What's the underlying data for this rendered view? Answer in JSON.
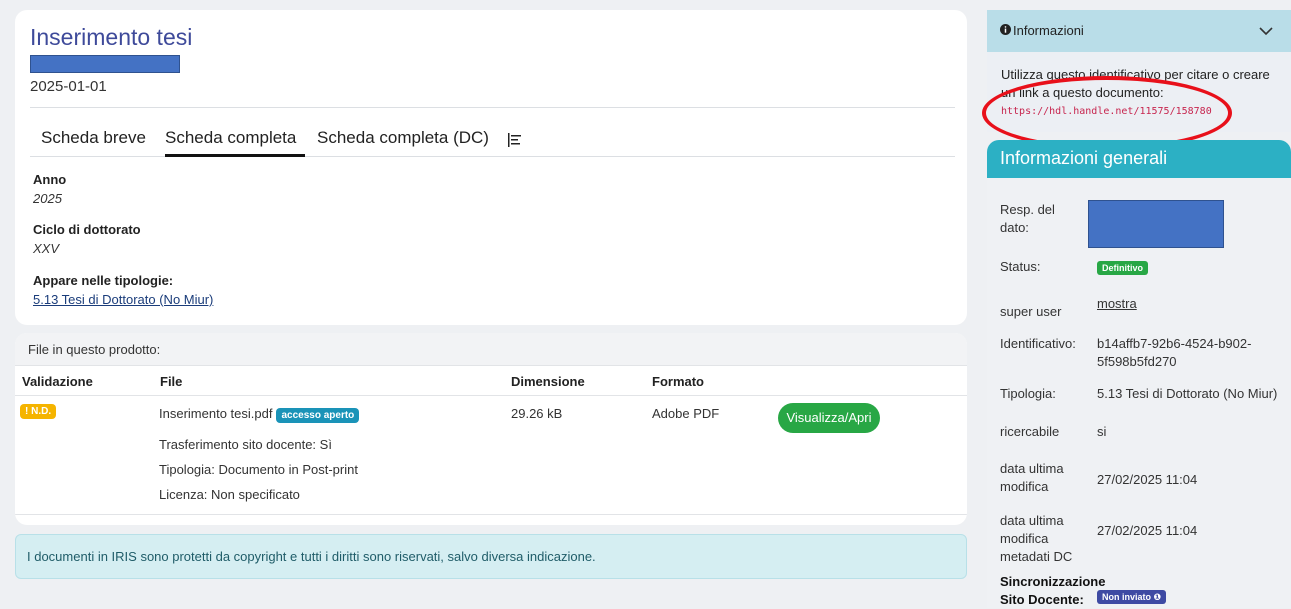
{
  "record": {
    "title": "Inserimento tesi",
    "date": "2025-01-01"
  },
  "tabs": [
    "Scheda breve",
    "Scheda completa",
    "Scheda completa (DC)"
  ],
  "fields": {
    "anno_label": "Anno",
    "anno_value": "2025",
    "ciclo_label": "Ciclo di dottorato",
    "ciclo_value": "XXV",
    "tipologie_label": "Appare nelle tipologie:",
    "tipologie_value": "5.13 Tesi di Dottorato (No Miur)"
  },
  "files": {
    "header": "File in questo prodotto:",
    "columns": [
      "Validazione",
      "File",
      "Dimensione",
      "Formato"
    ],
    "row": {
      "validation": "! N.D.",
      "filename": "Inserimento tesi.pdf",
      "access": "accesso aperto",
      "size": "29.26 kB",
      "format": "Adobe PDF",
      "button": "Visualizza/Apri",
      "details": [
        "Trasferimento sito docente: Sì",
        "Tipologia: Documento in Post-print",
        "Licenza: Non specificato"
      ]
    }
  },
  "notice": "I documenti in IRIS sono protetti da copyright e tutti i diritti sono riservati, salvo diversa indicazione.",
  "info_panel": {
    "title": "Informazioni",
    "text": "Utilizza questo identificativo per citare o creare un link a questo documento:",
    "url": "https://hdl.handle.net/11575/158780"
  },
  "general": {
    "title": "Informazioni generali",
    "resp_label": "Resp. del dato:",
    "status_label": "Status:",
    "status_value": "Definitivo",
    "superuser_label": "super user",
    "superuser_value": "mostra",
    "id_label": "Identificativo:",
    "id_value": "b14affb7-92b6-4524-b902-5f598b5fd270",
    "tipologia_label": "Tipologia:",
    "tipologia_value": "5.13 Tesi di Dottorato (No Miur)",
    "ricercabile_label": "ricercabile",
    "ricercabile_value": "si",
    "mod_label": "data ultima modifica",
    "mod_value": "27/02/2025 11:04",
    "moddc_label": "data ultima modifica metadati DC",
    "moddc_value": "27/02/2025 11:04",
    "sync_label": "Sincronizzazione Sito Docente:",
    "sync_value": "Non inviato"
  },
  "colors": {
    "accent": "#2cb0c4",
    "title": "#3e4a9a",
    "success": "#28a745",
    "warning": "#f5b400",
    "annotation": "#e8101a"
  }
}
